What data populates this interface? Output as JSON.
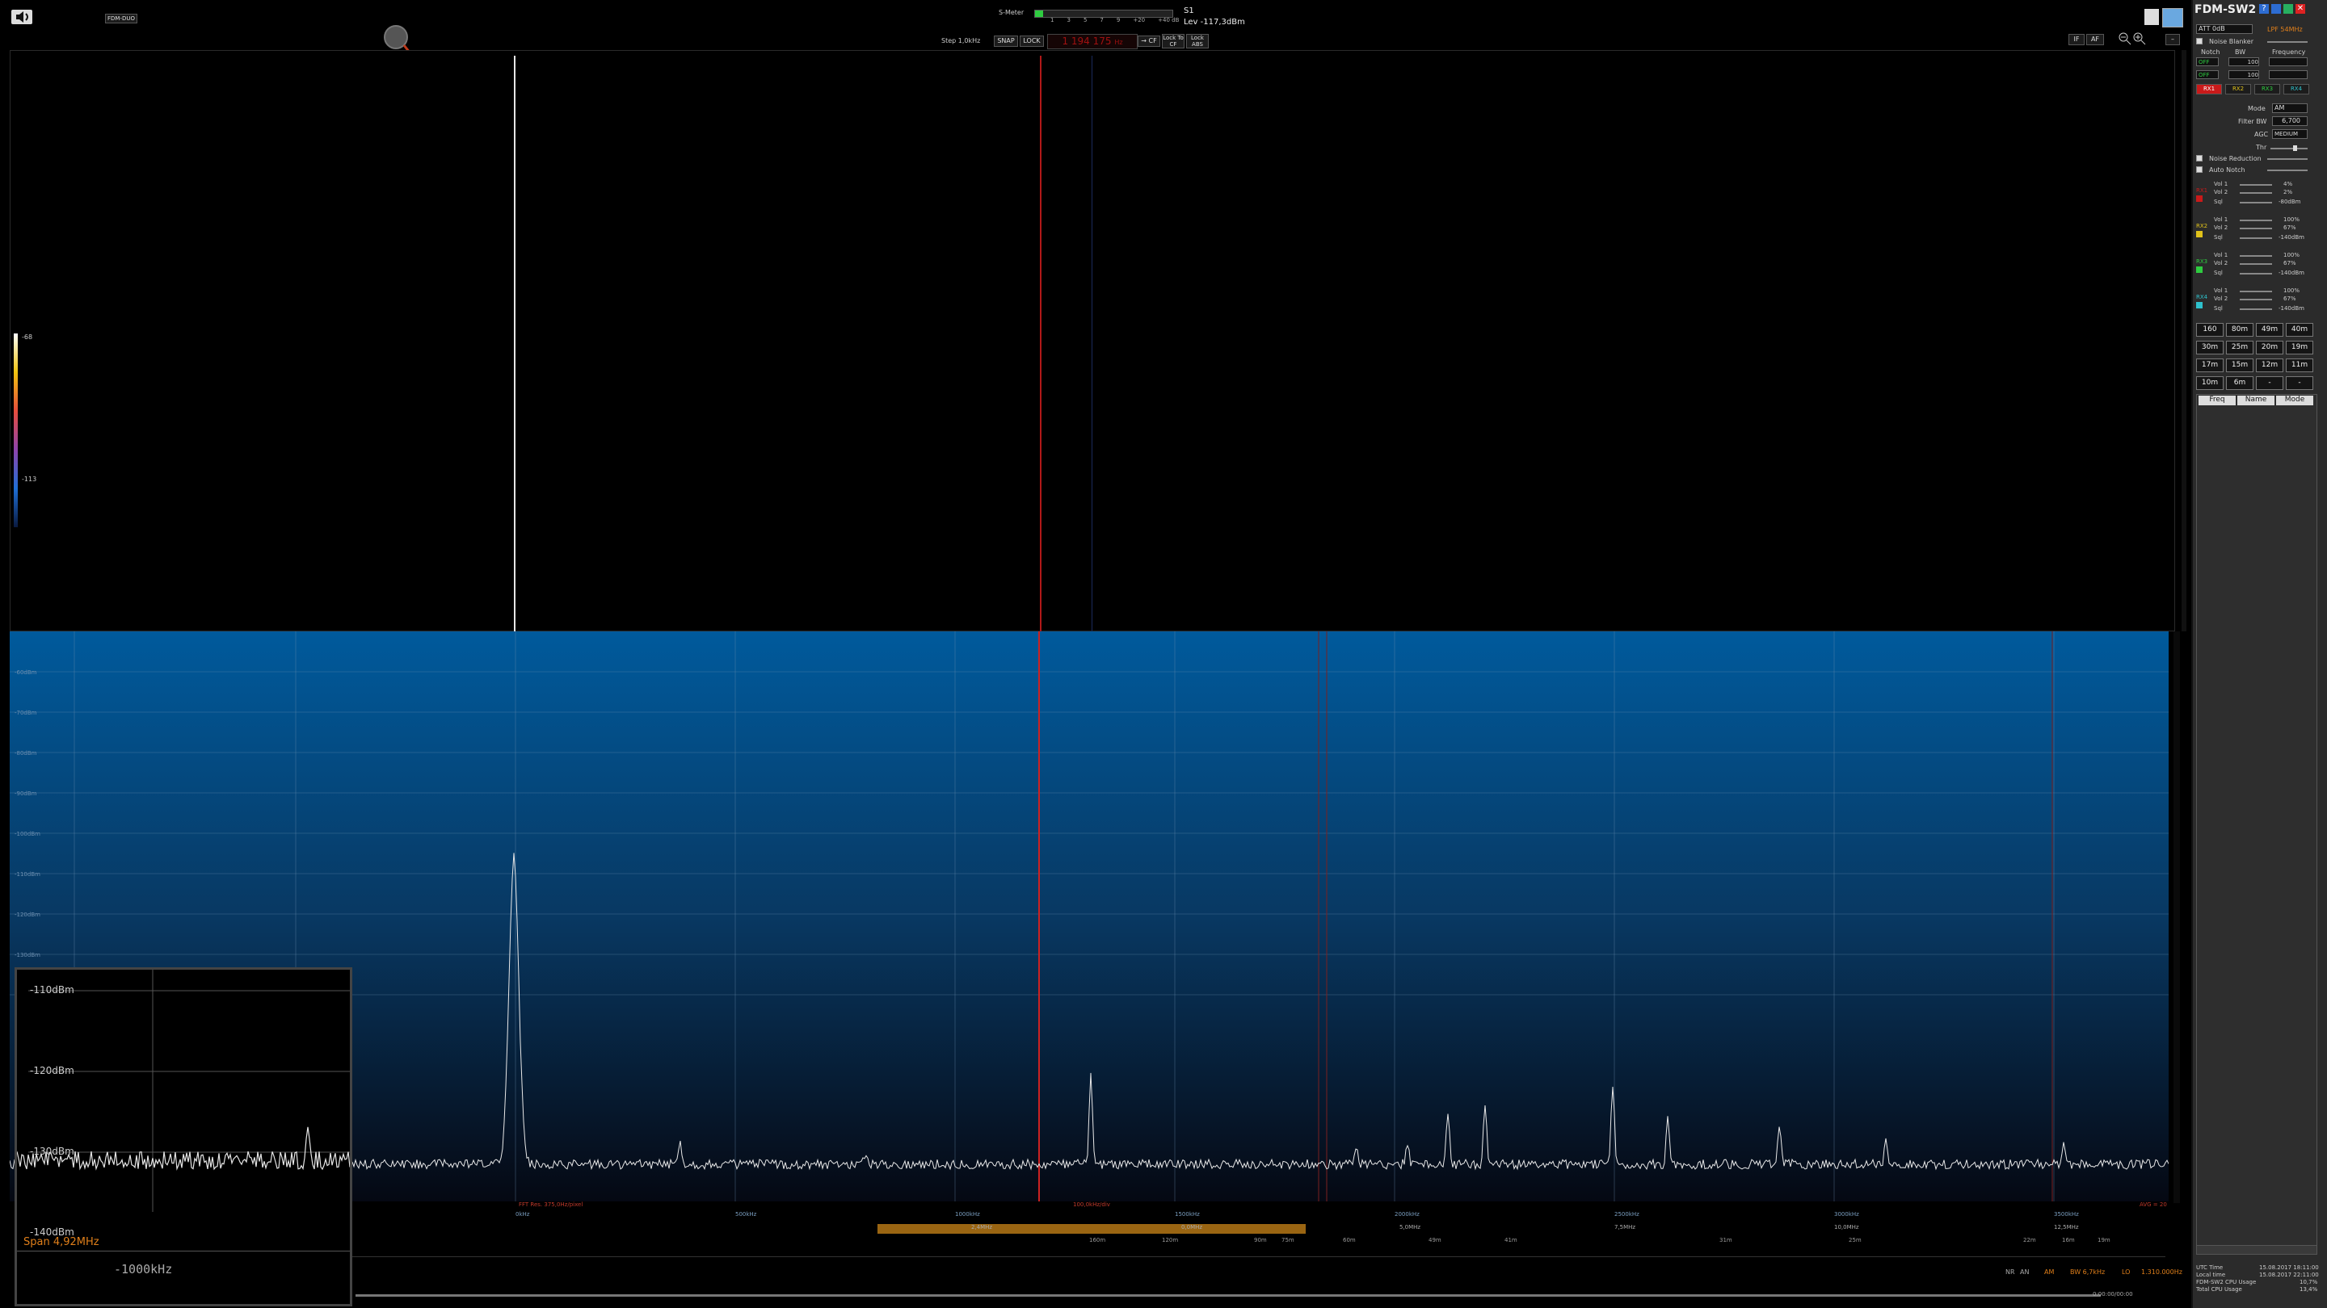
{
  "toolbar": {
    "device_label": "FDM-DUO",
    "smeter_label": "S-Meter",
    "smeter_scale": [
      "1",
      "3",
      "5",
      "7",
      "9",
      "+20",
      "+40 dB"
    ],
    "s_reading": "S1",
    "level_reading": "Lev -117,3dBm",
    "step_label": "Step 1,0kHz",
    "snap_label": "SNAP",
    "lock_label": "LOCK",
    "freq_digits": "1 194 175",
    "freq_unit": "Hz",
    "to_cf_label": "→ CF",
    "lock_to_cf_label": "Lock To CF",
    "lock_abs_label": "Lock ABS",
    "if_label": "IF",
    "af_label": "AF",
    "menu_dash": "–"
  },
  "waterfall": {
    "scale_top": "-68",
    "scale_bottom": "-113"
  },
  "spectrum": {
    "db_ticks": [
      "-60dBm",
      "-70dBm",
      "-80dBm",
      "-90dBm",
      "-100dBm",
      "-110dBm",
      "-120dBm",
      "-130dBm",
      "-140dBm"
    ],
    "freq_ticks": [
      "0kHz",
      "500kHz",
      "1000kHz",
      "1500kHz",
      "2000kHz",
      "2500kHz",
      "3000kHz",
      "3500kHz"
    ],
    "status_left": "FFT Res. 375,0Hz/pixel",
    "status_center": "100,0kHz/div",
    "status_right": "AVG = 20",
    "band_labels": [
      "2,4MHz",
      "0,0MHz",
      "5,0MHz",
      "7,5MHz",
      "10,0MHz",
      "12,5MHz"
    ],
    "meter_band_labels": [
      "160m",
      "120m",
      "90m",
      "75m",
      "60m",
      "49m",
      "41m",
      "31m",
      "25m",
      "22m",
      "19m",
      "16m"
    ]
  },
  "zoom_panel": {
    "labels": [
      "-110dBm",
      "-120dBm",
      "-130dBm",
      "-140dBm"
    ],
    "span": "Span 4,92MHz",
    "offset": "-1000kHz"
  },
  "status_bar": {
    "nr": "NR",
    "an": "AN",
    "mode": "AM",
    "bw": "BW 6,7kHz",
    "lo": "LO",
    "lo_freq": "1.310.000Hz",
    "utc_label": "UTC Time",
    "utc_val": "15.08.2017 18:11:00",
    "local_label": "Local time",
    "local_val": "15.08.2017 22:11:00",
    "fdm_cpu_label": "FDM-SW2 CPU Usage",
    "fdm_cpu_val": "10,7%",
    "total_cpu_label": "Total CPU Usage",
    "total_cpu_val": "13,4%",
    "time_counter": "0:00:00/00:00"
  },
  "right_panel": {
    "title": "FDM-SW2",
    "att": "ATT 0dB",
    "lpf": "LPF 54MHz",
    "noise_blanker": "Noise Blanker",
    "notch": "Notch",
    "bw": "BW",
    "frequency": "Frequency",
    "off1": "OFF",
    "off2": "OFF",
    "notch_val1": "100",
    "notch_val2": "100",
    "rx_buttons": [
      "RX1",
      "RX2",
      "RX3",
      "RX4"
    ],
    "mode_label": "Mode",
    "mode_val": "AM",
    "filter_bw_label": "Filter BW",
    "filter_bw_val": "6,700",
    "agc_label": "AGC",
    "agc_val": "MEDIUM",
    "thr_label": "Thr",
    "noise_reduction": "Noise Reduction",
    "auto_notch": "Auto Notch",
    "rx_blocks": [
      {
        "name": "RX1",
        "vol1": "4%",
        "vol2": "2%",
        "sql": "-80dBm"
      },
      {
        "name": "RX2",
        "vol1": "100%",
        "vol2": "67%",
        "sql": "-140dBm"
      },
      {
        "name": "RX3",
        "vol1": "100%",
        "vol2": "67%",
        "sql": "-140dBm"
      },
      {
        "name": "RX4",
        "vol1": "100%",
        "vol2": "67%",
        "sql": "-140dBm"
      }
    ],
    "vol1_label": "Vol 1",
    "vol2_label": "Vol 2",
    "sql_label": "Sql",
    "bands": [
      "160",
      "80m",
      "49m",
      "40m",
      "30m",
      "25m",
      "20m",
      "19m",
      "17m",
      "15m",
      "12m",
      "11m",
      "10m",
      "6m",
      "-",
      "-"
    ],
    "memory_headers": [
      "Freq",
      "Name",
      "Mode"
    ]
  }
}
